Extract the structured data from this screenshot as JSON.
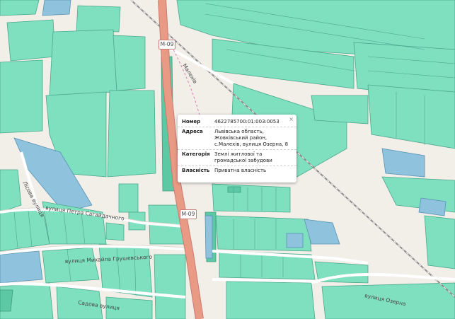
{
  "map": {
    "roads": {
      "m09_top": "M-09",
      "m09_bottom": "M-09",
      "malekhiv": "Малехів"
    },
    "streets": {
      "lisova": "Лісова вулиця",
      "saharidachnoho": "вулиця Петра Сагайдачного",
      "hrushevskoho": "вулиця Михайла Грушевського",
      "sadova": "Садова вулиця",
      "ozerna": "вулиця Озерна"
    },
    "colors": {
      "parcel": "#7fe0c0",
      "road_main": "#e89a84",
      "background": "#f2efe9"
    }
  },
  "popup": {
    "close_label": "×",
    "rows": [
      {
        "key": "Номер",
        "value": "4622785700:01:003:0053"
      },
      {
        "key": "Адреса",
        "value": "Львівська область, Жовківський район, с.Малехів, вулиця Озерна, 8"
      },
      {
        "key": "Категорія",
        "value": "Землі житлової та громадської забудови"
      },
      {
        "key": "Власність",
        "value": "Приватна власність"
      }
    ]
  }
}
